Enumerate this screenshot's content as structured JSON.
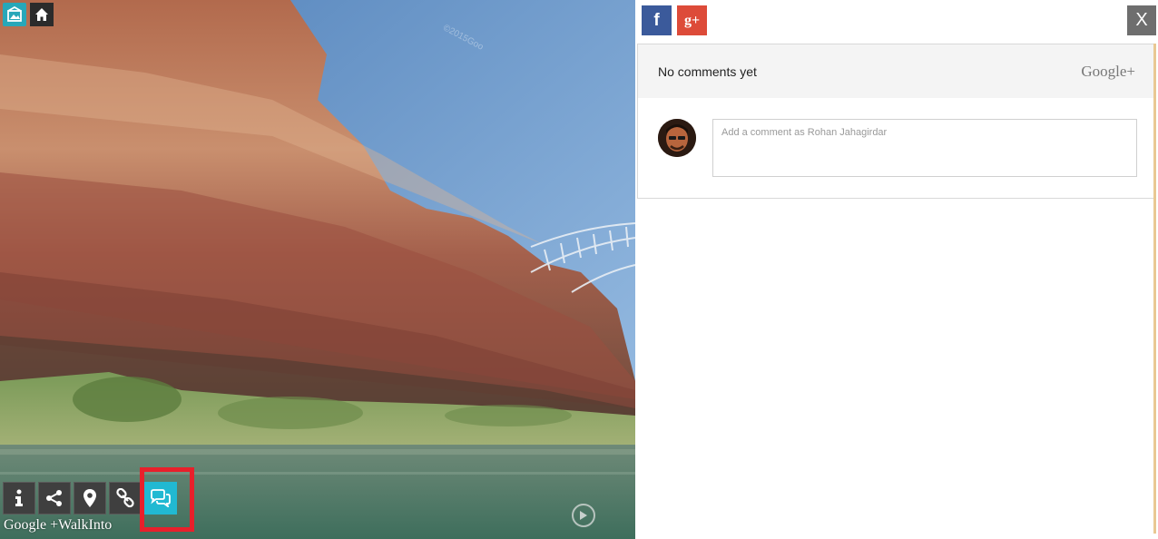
{
  "header": {
    "app_icon": "panorama-app-icon",
    "home_icon": "home-icon"
  },
  "pano": {
    "watermark": "©2015Goo",
    "brand": "Google +WalkInto"
  },
  "toolbar": {
    "buttons": [
      {
        "name": "info",
        "icon": "info-icon"
      },
      {
        "name": "share",
        "icon": "share-icon"
      },
      {
        "name": "location",
        "icon": "map-pin-icon"
      },
      {
        "name": "link",
        "icon": "link-icon"
      },
      {
        "name": "comments",
        "icon": "chat-icon",
        "active": true
      }
    ]
  },
  "panel": {
    "share": {
      "facebook_label": "f",
      "googleplus_label": "g+"
    },
    "close_label": "X",
    "comments": {
      "status": "No comments yet",
      "provider": "Google+",
      "placeholder": "Add a comment as Rohan Jahagirdar"
    }
  },
  "colors": {
    "accent": "#21b9d2",
    "highlight": "#e8202b",
    "facebook": "#3b5a9b",
    "googleplus": "#dd4b39"
  }
}
